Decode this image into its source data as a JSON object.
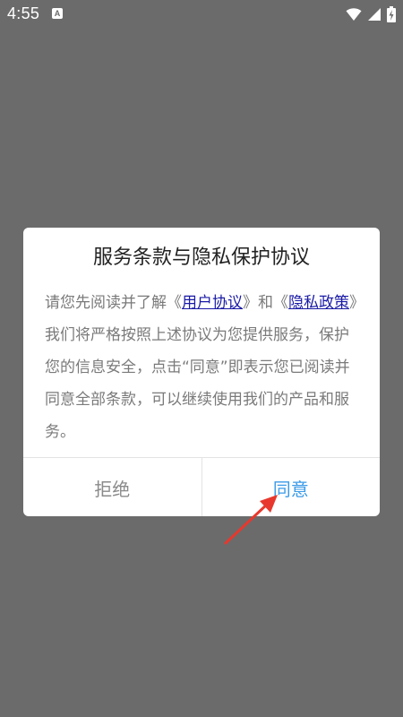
{
  "status_bar": {
    "time": "4:55",
    "notification_letter": "A",
    "icons": [
      "wifi-icon",
      "signal-icon",
      "battery-charging-icon"
    ]
  },
  "dialog": {
    "title": "服务条款与隐私保护协议",
    "body": {
      "text_1": "请您先阅读并了解《",
      "link_user_agreement": "用户协议",
      "text_2": "》和《",
      "link_privacy_policy": "隐私政策",
      "text_3": "》我们将严格按照上述协议为您提供服务，保护您的信息安全，点击“同意”即表示您已阅读并同意全部条款，可以继续使用我们的产品和服务。"
    },
    "buttons": {
      "reject": "拒绝",
      "agree": "同意"
    }
  },
  "colors": {
    "overlay": "#6b6b6b",
    "link": "#1a1aa6",
    "agree": "#3b9be8",
    "annotation_arrow": "#e8382d"
  }
}
